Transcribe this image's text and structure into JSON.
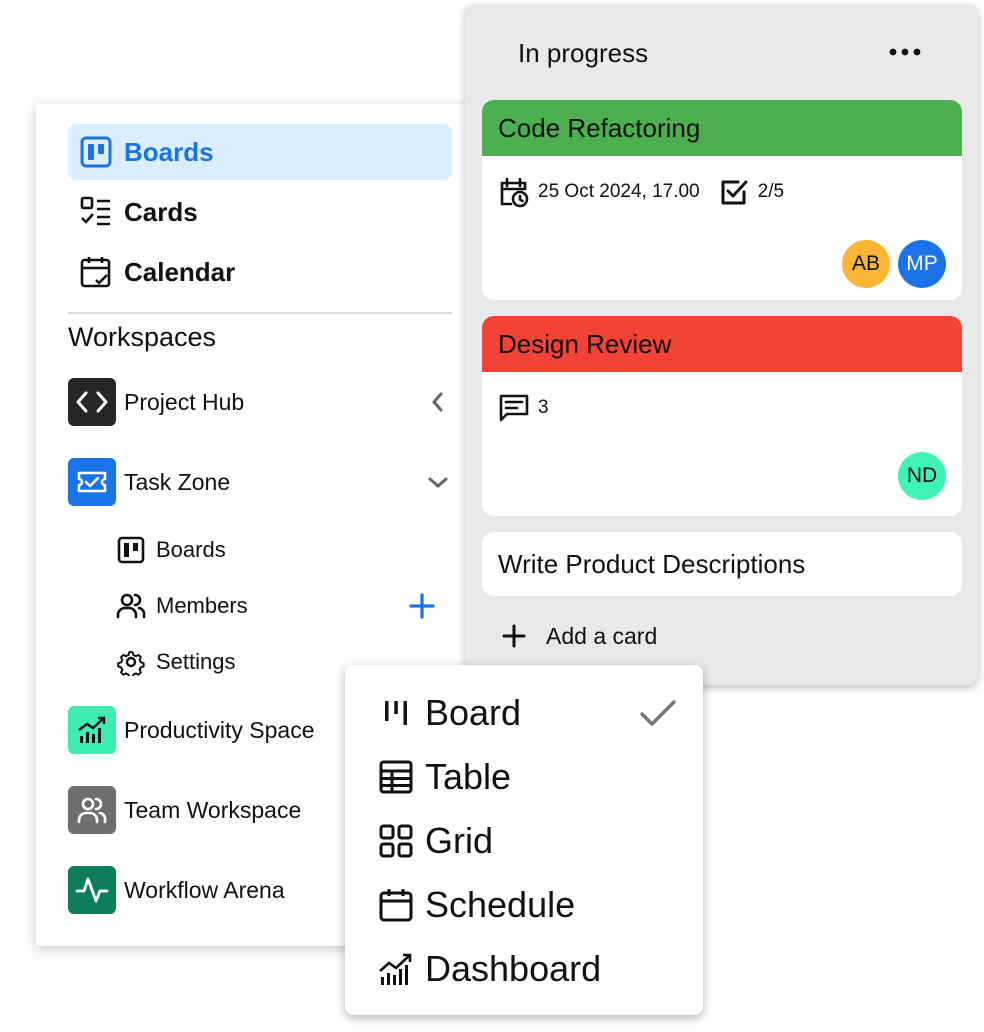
{
  "sidebar": {
    "nav": [
      {
        "label": "Boards",
        "icon": "boards-icon",
        "active": true
      },
      {
        "label": "Cards",
        "icon": "checklist-icon",
        "active": false
      },
      {
        "label": "Calendar",
        "icon": "calendar-check-icon",
        "active": false
      }
    ],
    "workspaces_title": "Workspaces",
    "workspaces": [
      {
        "label": "Project Hub",
        "icon": "code-icon",
        "color": "#262626",
        "expanded": false
      },
      {
        "label": "Task Zone",
        "icon": "ticket-icon",
        "color": "#1a73e8",
        "expanded": true,
        "children": [
          {
            "label": "Boards",
            "icon": "boards-icon"
          },
          {
            "label": "Members",
            "icon": "members-icon"
          },
          {
            "label": "Settings",
            "icon": "gear-icon"
          }
        ]
      },
      {
        "label": "Productivity Space",
        "icon": "chart-icon",
        "color": "#3dedb4"
      },
      {
        "label": "Team Workspace",
        "icon": "team-icon",
        "color": "#6e6e6e"
      },
      {
        "label": "Workflow Arena",
        "icon": "pulse-icon",
        "color": "#0e7d5f"
      }
    ],
    "accent": "#1a73e8"
  },
  "board": {
    "column_title": "In progress",
    "cards": [
      {
        "title": "Code Refactoring",
        "color": "#4caf50",
        "due": "25 Oct 2024, 17.00",
        "checklist": "2/5",
        "avatars": [
          {
            "initials": "AB",
            "color": "#fbb534"
          },
          {
            "initials": "MP",
            "color": "#1a73e8"
          }
        ]
      },
      {
        "title": "Design Review",
        "color": "#f44336",
        "comments": "3",
        "avatars": [
          {
            "initials": "ND",
            "color": "#3ef2b8"
          }
        ]
      },
      {
        "title": "Write Product Descriptions"
      }
    ],
    "add_card_label": "Add a card"
  },
  "view_menu": {
    "items": [
      {
        "label": "Board",
        "icon": "board-view-icon",
        "selected": true
      },
      {
        "label": "Table",
        "icon": "table-icon",
        "selected": false
      },
      {
        "label": "Grid",
        "icon": "grid-icon",
        "selected": false
      },
      {
        "label": "Schedule",
        "icon": "schedule-icon",
        "selected": false
      },
      {
        "label": "Dashboard",
        "icon": "dashboard-icon",
        "selected": false
      }
    ]
  }
}
